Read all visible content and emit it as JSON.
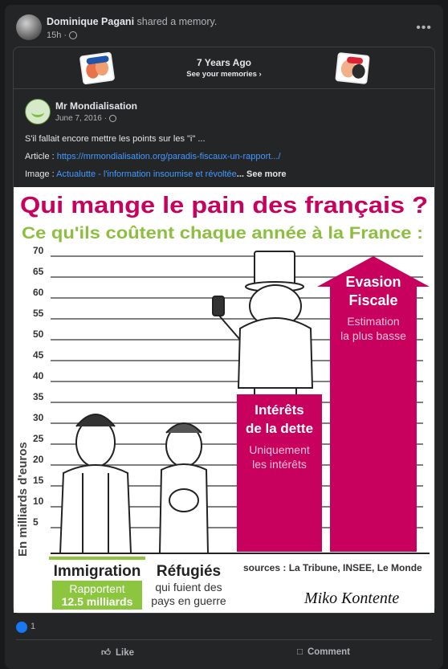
{
  "share": {
    "author": "Dominique Pagani",
    "action": "shared a memory.",
    "time": "15h"
  },
  "memory": {
    "title": "7 Years Ago",
    "link": "See your memories"
  },
  "post": {
    "author": "Mr Mondialisation",
    "date": "June 7, 2016",
    "line1": "S'il fallait encore mettre les points sur les \"i\" ...",
    "line2_label": "Article : ",
    "line2_link": "https://mrmondialisation.org/paradis-fiscaux-un-rapport.../",
    "line3_label": "Image : ",
    "line3_link": "Actualutte - l'information insoumise et révoltée",
    "line3_more": "... See more"
  },
  "image": {
    "title": "Qui mange le pain des français ?",
    "subtitle": "Ce qu'ils coûtent chaque année à la France :",
    "ylabel": "En milliards d'euros",
    "ticks": [
      "70",
      "65",
      "60",
      "55",
      "50",
      "45",
      "40",
      "35",
      "30",
      "25",
      "20",
      "15",
      "10",
      "5"
    ],
    "bar1_l1": "Intérêts",
    "bar1_l2": "de la dette",
    "bar1_sub1": "Uniquement",
    "bar1_sub2": "les intérêts",
    "bar2_l1": "Evasion",
    "bar2_l2": "Fiscale",
    "bar2_sub1": "Estimation",
    "bar2_sub2": "la plus basse",
    "immig": "Immigration",
    "immig_sub1": "Rapportent",
    "immig_sub2": "12.5 milliards",
    "refug": "Réfugiés",
    "refug_sub1": "qui fuient des",
    "refug_sub2": "pays en guerre",
    "sources": "sources :  La Tribune, INSEE, Le Monde",
    "signature": "Miko Kontente"
  },
  "reactions": {
    "count": "1"
  },
  "actions": {
    "like": "Like",
    "comment": "Comment"
  },
  "colors": {
    "accent_magenta": "#c8005e",
    "subtitle_green": "#8cbf3f",
    "immig_green": "#8cc63f",
    "link_blue": "#4599ff"
  }
}
